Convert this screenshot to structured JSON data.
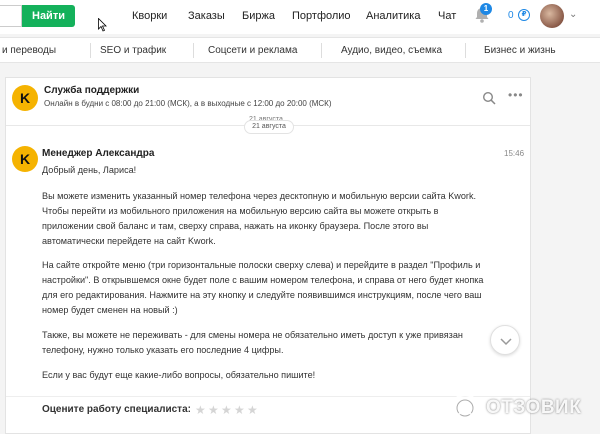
{
  "topnav": {
    "find_button": "Найти",
    "items": [
      "Кворки",
      "Заказы",
      "Биржа",
      "Портфолио",
      "Аналитика",
      "Чат"
    ],
    "notification_count": "1",
    "balance": "0",
    "currency_symbol": "₽"
  },
  "categories": [
    "и переводы",
    "SEO и трафик",
    "Соцсети и реклама",
    "Аудио, видео, съемка",
    "Бизнес и жизнь"
  ],
  "chat": {
    "support_title": "Служба поддержки",
    "support_hours": "Онлайн в будни с 08:00 до 21:00 (МСК), а в выходные с 12:00 до 20:00 (МСК)",
    "date_ghost": "21 августа",
    "date_pill": "21 августа",
    "logo_letter": "K",
    "message": {
      "sender": "Менеджер Александра",
      "time": "15:46",
      "greeting": "Добрый день, Лариса!",
      "p1_lines": [
        "Вы можете изменить указанный номер телефона через десктопную и мобильную версии сайта Kwork.",
        "Чтобы перейти из мобильного приложения на мобильную версию сайта вы можете открыть в",
        "приложении свой баланс и там, сверху справа, нажать на иконку браузера. После этого вы",
        "автоматически перейдете на сайт Kwork."
      ],
      "p2_lines": [
        "На сайте откройте меню (три горизонтальные полоски сверху слева) и перейдите в раздел \"Профиль и",
        "настройки\". В открывшемся окне будет поле с вашим номером телефона, и справа от него будет кнопка",
        "для его редактирования. Нажмите на эту кнопку и следуйте появившимся инструкциям, после чего ваш",
        "номер будет сменен на новый :)"
      ],
      "p3_lines": [
        "Также, вы можете не переживать - для смены номера не обязательно иметь доступ к уже привязан",
        "телефону, нужно только указать его последние 4 цифры."
      ],
      "p4": "Если у вас будут еще какие-либо вопросы, обязательно пишите!"
    },
    "rating_label": "Оцените работу специалиста:",
    "rating_stars": 0,
    "rating_max": 5
  },
  "watermark": {
    "text": "ОТЗОВИК"
  },
  "colors": {
    "accent_green": "#14b15b",
    "link_blue": "#1e88e5",
    "logo_yellow": "#f5b301"
  }
}
